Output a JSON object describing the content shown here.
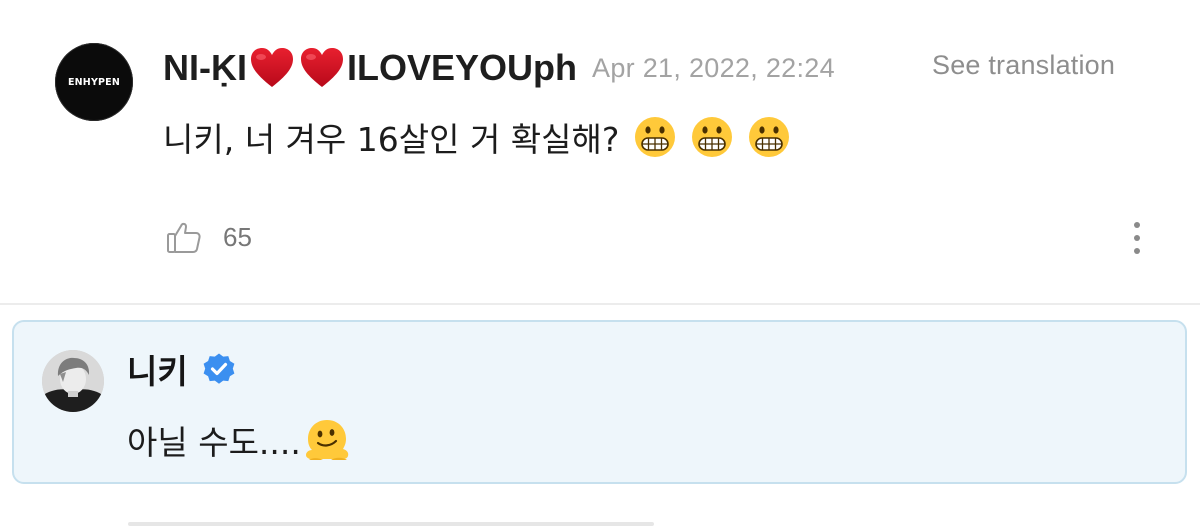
{
  "comment": {
    "avatar_label": "ENHYPEN",
    "username_prefix": "NI-ḲI",
    "username_suffix": "ILOVEYOUph",
    "name_icons": [
      "heart-icon",
      "heart-icon"
    ],
    "timestamp": "Apr 21, 2022, 22:24",
    "translate_label": "See translation",
    "text": "니키, 너 겨우 16살인 거 확실해?",
    "text_emojis": [
      "grimacing-face-icon",
      "grimacing-face-icon",
      "grimacing-face-icon"
    ],
    "like_count": "65",
    "icons": {
      "like": "thumbs-up-icon",
      "more": "more-vertical-icon"
    }
  },
  "reply": {
    "username": "니키",
    "verified_icon": "verified-badge-icon",
    "text": "아닐 수도....",
    "text_emoji": "melting-face-icon"
  },
  "colors": {
    "heart": "#d0021b",
    "verified": "#3b8ff0",
    "reply_bg": "#eef6fb",
    "reply_border": "#c6e0ee",
    "timestamp": "#a3a3a3",
    "emoji_yellow": "#ffc93a"
  }
}
